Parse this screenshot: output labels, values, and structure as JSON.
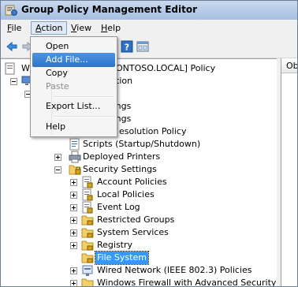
{
  "window": {
    "title": "Group Policy Management Editor"
  },
  "menubar": {
    "items": [
      {
        "label": "File",
        "u": "F",
        "rest": "ile"
      },
      {
        "label": "Action",
        "u": "A",
        "rest": "ction"
      },
      {
        "label": "View",
        "u": "V",
        "rest": "iew"
      },
      {
        "label": "Help",
        "u": "H",
        "rest": "elp"
      }
    ]
  },
  "action_menu": {
    "open": "Open",
    "add_file": "Add File...",
    "copy": "Copy",
    "paste": "Paste",
    "export_list": "Export List...",
    "help": "Help"
  },
  "tree": {
    "root_prefix": "W",
    "root_suffix": "ONTOSO.LOCAL] Policy",
    "computer_config_suffix": "tion",
    "settings_a": "ttings",
    "settings_b": "ttings",
    "name_resolution": "esolution Policy",
    "scripts": "Scripts (Startup/Shutdown)",
    "deployed_printers": "Deployed Printers",
    "security_settings": "Security Settings",
    "account_policies": "Account Policies",
    "local_policies": "Local Policies",
    "event_log": "Event Log",
    "restricted_groups": "Restricted Groups",
    "system_services": "System Services",
    "registry": "Registry",
    "file_system": "File System",
    "wired_network": "Wired Network (IEEE 802.3) Policies",
    "windows_firewall": "Windows Firewall with Advanced Security"
  },
  "right_pane": {
    "header": "Ob"
  },
  "colors": {
    "selection": "#3399ff",
    "menu_highlight": "#3e86d6",
    "folder": "#f2cf6b",
    "lock": "#d6a21a"
  }
}
